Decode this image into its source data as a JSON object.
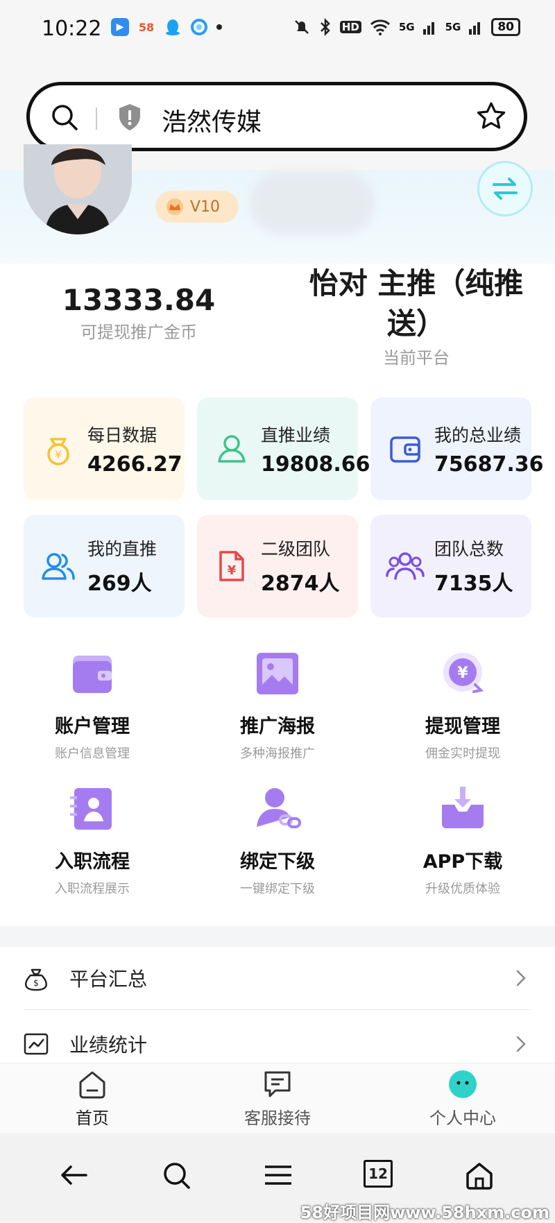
{
  "status_bar": {
    "time": "10:22",
    "app_58": "58",
    "hd": "HD",
    "net1": "5G",
    "net2": "5G",
    "battery": "80"
  },
  "search": {
    "text": "浩然传媒"
  },
  "profile": {
    "vip_level": "V10"
  },
  "summary": {
    "coins_value": "13333.84",
    "coins_label": "可提现推广金币",
    "platform_name": "怡对 主推（纯推送）",
    "platform_label": "当前平台"
  },
  "stats": [
    {
      "label": "每日数据",
      "value": "4266.27",
      "icon": "money-bag-icon",
      "bg": "#fff7ea"
    },
    {
      "label": "直推业绩",
      "value": "19808.66",
      "icon": "user-outline-icon",
      "bg": "#eaf8f5"
    },
    {
      "label": "我的总业绩",
      "value": "75687.36",
      "icon": "wallet-icon",
      "bg": "#eef3fd"
    },
    {
      "label": "我的直推",
      "value": "269人",
      "icon": "users-icon",
      "bg": "#eef5fd"
    },
    {
      "label": "二级团队",
      "value": "2874人",
      "icon": "yuan-doc-icon",
      "bg": "#fdf0ef"
    },
    {
      "label": "团队总数",
      "value": "7135人",
      "icon": "group-icon",
      "bg": "#f3f0fd"
    }
  ],
  "menu": [
    {
      "title": "账户管理",
      "sub": "账户信息管理",
      "icon": "wallet-purple-icon"
    },
    {
      "title": "推广海报",
      "sub": "多种海报推广",
      "icon": "poster-icon"
    },
    {
      "title": "提现管理",
      "sub": "佣金实时提现",
      "icon": "withdraw-icon"
    },
    {
      "title": "入职流程",
      "sub": "入职流程展示",
      "icon": "id-card-icon"
    },
    {
      "title": "绑定下级",
      "sub": "一键绑定下级",
      "icon": "bind-user-icon"
    },
    {
      "title": "APP下载",
      "sub": "升级优质体验",
      "icon": "download-icon"
    }
  ],
  "list": [
    {
      "label": "平台汇总",
      "icon": "money-sack-icon"
    },
    {
      "label": "业绩统计",
      "icon": "chart-icon"
    }
  ],
  "tabs": [
    {
      "label": "首页",
      "icon": "home-tab-icon"
    },
    {
      "label": "客服接待",
      "icon": "chat-icon"
    },
    {
      "label": "个人中心",
      "icon": "profile-face-icon"
    }
  ],
  "nav": {
    "tab_count": "12"
  },
  "watermark": "58好项目网www.58hxm.com",
  "colors": {
    "accent_purple": "#a57cf0",
    "accent_cyan": "#2ec7d6",
    "vip_orange": "#b9702a"
  }
}
